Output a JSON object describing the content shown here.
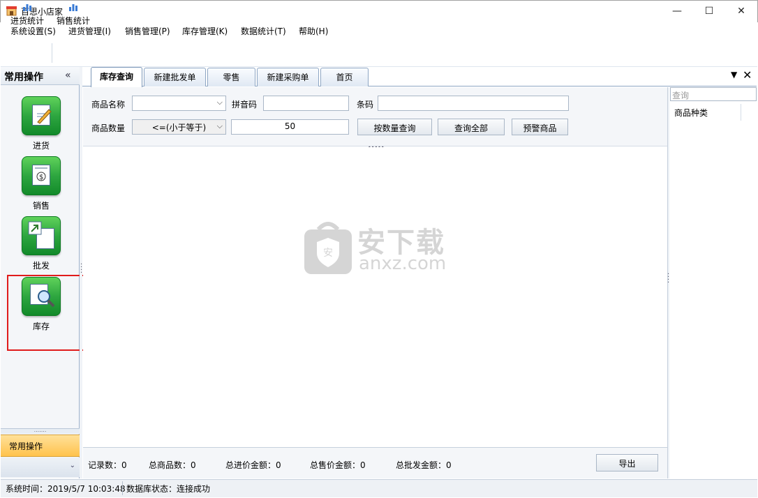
{
  "window": {
    "title": "百思小店家",
    "minimize": "—",
    "maximize": "☐",
    "close": "✕"
  },
  "menu": [
    "系统设置(S)",
    "进货管理(I)",
    "销售管理(P)",
    "库存管理(K)",
    "数据统计(T)",
    "帮助(H)"
  ],
  "toolbar": {
    "purchase_stats": "进货统计",
    "sales_stats": "销售统计"
  },
  "left_panel": {
    "title": "常用操作",
    "collapse_glyph": "«",
    "items": [
      {
        "label": "进货",
        "icon": "purchase-icon"
      },
      {
        "label": "销售",
        "icon": "sales-icon"
      },
      {
        "label": "批发",
        "icon": "wholesale-icon"
      },
      {
        "label": "库存",
        "icon": "inventory-icon"
      }
    ],
    "active_group": "常用操作",
    "bottom_arrow": "⌄"
  },
  "tabs": [
    {
      "label": "库存查询",
      "active": true
    },
    {
      "label": "新建批发单",
      "active": false
    },
    {
      "label": "零售",
      "active": false
    },
    {
      "label": "新建采购单",
      "active": false
    },
    {
      "label": "首页",
      "active": false
    }
  ],
  "tab_controls": {
    "dropdown": "▼",
    "close": "✕"
  },
  "query": {
    "product_name_label": "商品名称",
    "product_name_value": "",
    "pinyin_label": "拼音码",
    "pinyin_value": "",
    "barcode_label": "条码",
    "barcode_value": "",
    "quantity_label": "商品数量",
    "comparator_value": "<=(小于等于)",
    "quantity_value": "50",
    "btn_query_by_qty": "按数量查询",
    "btn_query_all": "查询全部",
    "btn_warning": "预警商品"
  },
  "watermark": {
    "cn": "安下载",
    "en": "anxz.com"
  },
  "summary": {
    "records": "记录数：0",
    "total_products": "总商品数：0",
    "total_purchase": "总进价金额：0",
    "total_sale": "总售价金额：0",
    "total_wholesale": "总批发金额：0",
    "export": "导出"
  },
  "right_panel": {
    "search_placeholder": "查询",
    "tree_root": "商品种类"
  },
  "status": {
    "time": "系统时间：2019/5/7 10:03:48",
    "db": "数据库状态：连接成功"
  }
}
